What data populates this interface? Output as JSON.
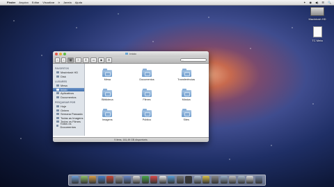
{
  "menubar": {
    "apple": "",
    "items": [
      "Finder",
      "Arquivo",
      "Editar",
      "Visualizar",
      "Ir",
      "Janela",
      "Ajuda"
    ],
    "right": [
      "✦",
      "◉",
      "◀)",
      "☰",
      "🔍"
    ]
  },
  "desktop": {
    "hd_label": "Macintosh HD",
    "file_label": "TC Meta"
  },
  "window": {
    "title": "Início",
    "search_placeholder": "",
    "sidebar": {
      "favorites_header": "FAVORITOS",
      "favorites": [
        "Macintosh HD",
        "Disk",
        "Mesa",
        "Início",
        "Aplicativos",
        "Documentos"
      ],
      "search_header": "PESQUISAR POR",
      "search_items": [
        "Hoje",
        "Ontem",
        "Semana Passada",
        "Todas as Imagens",
        "Todos os Filmes",
        "Todos os Documentos"
      ]
    },
    "folders": [
      "Mesa",
      "Documentos",
      "Transferências",
      "Biblioteca",
      "Filmes",
      "Música",
      "Imagens",
      "Público",
      "Sites"
    ],
    "status": "9 itens, 161,49 GB disponíveis"
  },
  "dock": {
    "colors": [
      "#6fa0d8",
      "#8fc06a",
      "#d8a04a",
      "#4a80c8",
      "#c94a3a",
      "#a0a0a0",
      "#6a8acb",
      "#dcdcdc",
      "#4aa84a",
      "#d84a4a",
      "#e8e8e8",
      "#5aa0d8",
      "#7a7a7a",
      "#3a3a3a",
      "#b0c0d0",
      "#d8c04a",
      "#888888",
      "#9ab0c8",
      "#c0c0c0",
      "#a8b8c8",
      "#dddddd",
      "#7080a0"
    ]
  }
}
